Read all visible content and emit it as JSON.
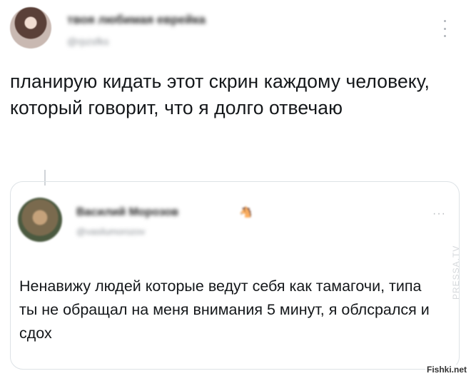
{
  "tweet": {
    "author_name": "твоя любимая еврейка",
    "author_handle": "@rpzsfks",
    "more_icon": "vertical-ellipsis-icon",
    "text": "планирую кидать этот скрин каждому человеку, который говорит, что я долго отвечаю"
  },
  "quoted_tweet": {
    "author_name": "Василий Морозов",
    "author_badge": "🐴",
    "author_handle": "@vasilumorozov",
    "more_label": "···",
    "text": "Ненавижу людей которые ведут себя как тамагочи, типа ты не обращал на меня внимания 5 минут, я облсрался и сдох"
  },
  "watermarks": {
    "vertical": "PRESSA.TV",
    "corner": "Fishki.net"
  }
}
